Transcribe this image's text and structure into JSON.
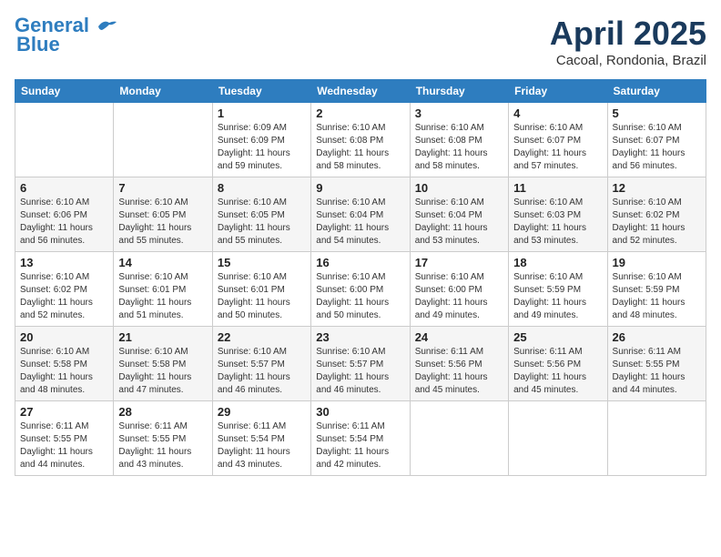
{
  "header": {
    "logo_line1": "General",
    "logo_line2": "Blue",
    "month": "April 2025",
    "location": "Cacoal, Rondonia, Brazil"
  },
  "weekdays": [
    "Sunday",
    "Monday",
    "Tuesday",
    "Wednesday",
    "Thursday",
    "Friday",
    "Saturday"
  ],
  "weeks": [
    [
      {
        "day": "",
        "info": ""
      },
      {
        "day": "",
        "info": ""
      },
      {
        "day": "1",
        "info": "Sunrise: 6:09 AM\nSunset: 6:09 PM\nDaylight: 11 hours and 59 minutes."
      },
      {
        "day": "2",
        "info": "Sunrise: 6:10 AM\nSunset: 6:08 PM\nDaylight: 11 hours and 58 minutes."
      },
      {
        "day": "3",
        "info": "Sunrise: 6:10 AM\nSunset: 6:08 PM\nDaylight: 11 hours and 58 minutes."
      },
      {
        "day": "4",
        "info": "Sunrise: 6:10 AM\nSunset: 6:07 PM\nDaylight: 11 hours and 57 minutes."
      },
      {
        "day": "5",
        "info": "Sunrise: 6:10 AM\nSunset: 6:07 PM\nDaylight: 11 hours and 56 minutes."
      }
    ],
    [
      {
        "day": "6",
        "info": "Sunrise: 6:10 AM\nSunset: 6:06 PM\nDaylight: 11 hours and 56 minutes."
      },
      {
        "day": "7",
        "info": "Sunrise: 6:10 AM\nSunset: 6:05 PM\nDaylight: 11 hours and 55 minutes."
      },
      {
        "day": "8",
        "info": "Sunrise: 6:10 AM\nSunset: 6:05 PM\nDaylight: 11 hours and 55 minutes."
      },
      {
        "day": "9",
        "info": "Sunrise: 6:10 AM\nSunset: 6:04 PM\nDaylight: 11 hours and 54 minutes."
      },
      {
        "day": "10",
        "info": "Sunrise: 6:10 AM\nSunset: 6:04 PM\nDaylight: 11 hours and 53 minutes."
      },
      {
        "day": "11",
        "info": "Sunrise: 6:10 AM\nSunset: 6:03 PM\nDaylight: 11 hours and 53 minutes."
      },
      {
        "day": "12",
        "info": "Sunrise: 6:10 AM\nSunset: 6:02 PM\nDaylight: 11 hours and 52 minutes."
      }
    ],
    [
      {
        "day": "13",
        "info": "Sunrise: 6:10 AM\nSunset: 6:02 PM\nDaylight: 11 hours and 52 minutes."
      },
      {
        "day": "14",
        "info": "Sunrise: 6:10 AM\nSunset: 6:01 PM\nDaylight: 11 hours and 51 minutes."
      },
      {
        "day": "15",
        "info": "Sunrise: 6:10 AM\nSunset: 6:01 PM\nDaylight: 11 hours and 50 minutes."
      },
      {
        "day": "16",
        "info": "Sunrise: 6:10 AM\nSunset: 6:00 PM\nDaylight: 11 hours and 50 minutes."
      },
      {
        "day": "17",
        "info": "Sunrise: 6:10 AM\nSunset: 6:00 PM\nDaylight: 11 hours and 49 minutes."
      },
      {
        "day": "18",
        "info": "Sunrise: 6:10 AM\nSunset: 5:59 PM\nDaylight: 11 hours and 49 minutes."
      },
      {
        "day": "19",
        "info": "Sunrise: 6:10 AM\nSunset: 5:59 PM\nDaylight: 11 hours and 48 minutes."
      }
    ],
    [
      {
        "day": "20",
        "info": "Sunrise: 6:10 AM\nSunset: 5:58 PM\nDaylight: 11 hours and 48 minutes."
      },
      {
        "day": "21",
        "info": "Sunrise: 6:10 AM\nSunset: 5:58 PM\nDaylight: 11 hours and 47 minutes."
      },
      {
        "day": "22",
        "info": "Sunrise: 6:10 AM\nSunset: 5:57 PM\nDaylight: 11 hours and 46 minutes."
      },
      {
        "day": "23",
        "info": "Sunrise: 6:10 AM\nSunset: 5:57 PM\nDaylight: 11 hours and 46 minutes."
      },
      {
        "day": "24",
        "info": "Sunrise: 6:11 AM\nSunset: 5:56 PM\nDaylight: 11 hours and 45 minutes."
      },
      {
        "day": "25",
        "info": "Sunrise: 6:11 AM\nSunset: 5:56 PM\nDaylight: 11 hours and 45 minutes."
      },
      {
        "day": "26",
        "info": "Sunrise: 6:11 AM\nSunset: 5:55 PM\nDaylight: 11 hours and 44 minutes."
      }
    ],
    [
      {
        "day": "27",
        "info": "Sunrise: 6:11 AM\nSunset: 5:55 PM\nDaylight: 11 hours and 44 minutes."
      },
      {
        "day": "28",
        "info": "Sunrise: 6:11 AM\nSunset: 5:55 PM\nDaylight: 11 hours and 43 minutes."
      },
      {
        "day": "29",
        "info": "Sunrise: 6:11 AM\nSunset: 5:54 PM\nDaylight: 11 hours and 43 minutes."
      },
      {
        "day": "30",
        "info": "Sunrise: 6:11 AM\nSunset: 5:54 PM\nDaylight: 11 hours and 42 minutes."
      },
      {
        "day": "",
        "info": ""
      },
      {
        "day": "",
        "info": ""
      },
      {
        "day": "",
        "info": ""
      }
    ]
  ]
}
